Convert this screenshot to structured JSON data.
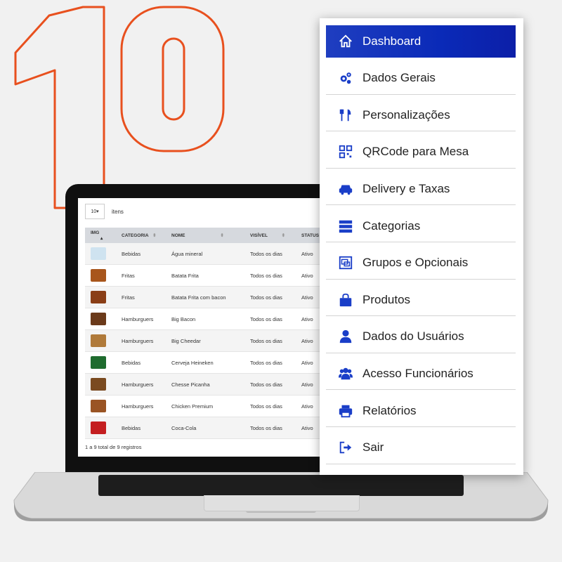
{
  "hero": {
    "number": "10"
  },
  "table": {
    "entries": {
      "select_value": "10",
      "label": "itens"
    },
    "columns": [
      "IMG",
      "CATEGORIA",
      "NOME",
      "VISÍVEL",
      "STATUS"
    ],
    "rows": [
      {
        "categoria": "Bebidas",
        "nome": "Água mineral",
        "visivel": "Todos os dias",
        "status": "Ativo",
        "thumb_color": "#cfe3f0"
      },
      {
        "categoria": "Fritas",
        "nome": "Batata Frita",
        "visivel": "Todos os dias",
        "status": "Ativo",
        "thumb_color": "#a8561c"
      },
      {
        "categoria": "Fritas",
        "nome": "Batata Frita com bacon",
        "visivel": "Todos os dias",
        "status": "Ativo",
        "thumb_color": "#8a3e16"
      },
      {
        "categoria": "Hamburguers",
        "nome": "Big Bacon",
        "visivel": "Todos os dias",
        "status": "Ativo",
        "thumb_color": "#6b3a1a"
      },
      {
        "categoria": "Hamburguers",
        "nome": "Big Cheedar",
        "visivel": "Todos os dias",
        "status": "Ativo",
        "thumb_color": "#b07a3a"
      },
      {
        "categoria": "Bebidas",
        "nome": "Cerveja Heineken",
        "visivel": "Todos os dias",
        "status": "Ativo",
        "thumb_color": "#1e6b2e"
      },
      {
        "categoria": "Hamburguers",
        "nome": "Chesse Picanha",
        "visivel": "Todos os dias",
        "status": "Ativo",
        "thumb_color": "#7a4a20"
      },
      {
        "categoria": "Hamburguers",
        "nome": "Chicken Premium",
        "visivel": "Todos os dias",
        "status": "Ativo",
        "thumb_color": "#9a5424"
      },
      {
        "categoria": "Bebidas",
        "nome": "Coca-Cola",
        "visivel": "Todos os dias",
        "status": "Ativo",
        "thumb_color": "#c41e20"
      }
    ],
    "footer": "1 a 9 total de 9 registros"
  },
  "menu": {
    "items": [
      {
        "label": "Dashboard",
        "icon": "home-icon"
      },
      {
        "label": "Dados Gerais",
        "icon": "gears-icon"
      },
      {
        "label": "Personalizações",
        "icon": "utensils-icon"
      },
      {
        "label": "QRCode para Mesa",
        "icon": "qrcode-icon"
      },
      {
        "label": "Delivery e Taxas",
        "icon": "car-icon"
      },
      {
        "label": "Categorias",
        "icon": "server-icon"
      },
      {
        "label": "Grupos e Opcionais",
        "icon": "object-group-icon"
      },
      {
        "label": "Produtos",
        "icon": "shopping-bag-icon"
      },
      {
        "label": "Dados do Usuários",
        "icon": "user-icon"
      },
      {
        "label": "Acesso Funcionários",
        "icon": "users-icon"
      },
      {
        "label": "Relatórios",
        "icon": "print-icon"
      },
      {
        "label": "Sair",
        "icon": "sign-out-icon"
      }
    ]
  },
  "colors": {
    "accent_orange": "#e8501e",
    "menu_active": "#0a2ab8",
    "icon_blue": "#1a3ec8"
  }
}
